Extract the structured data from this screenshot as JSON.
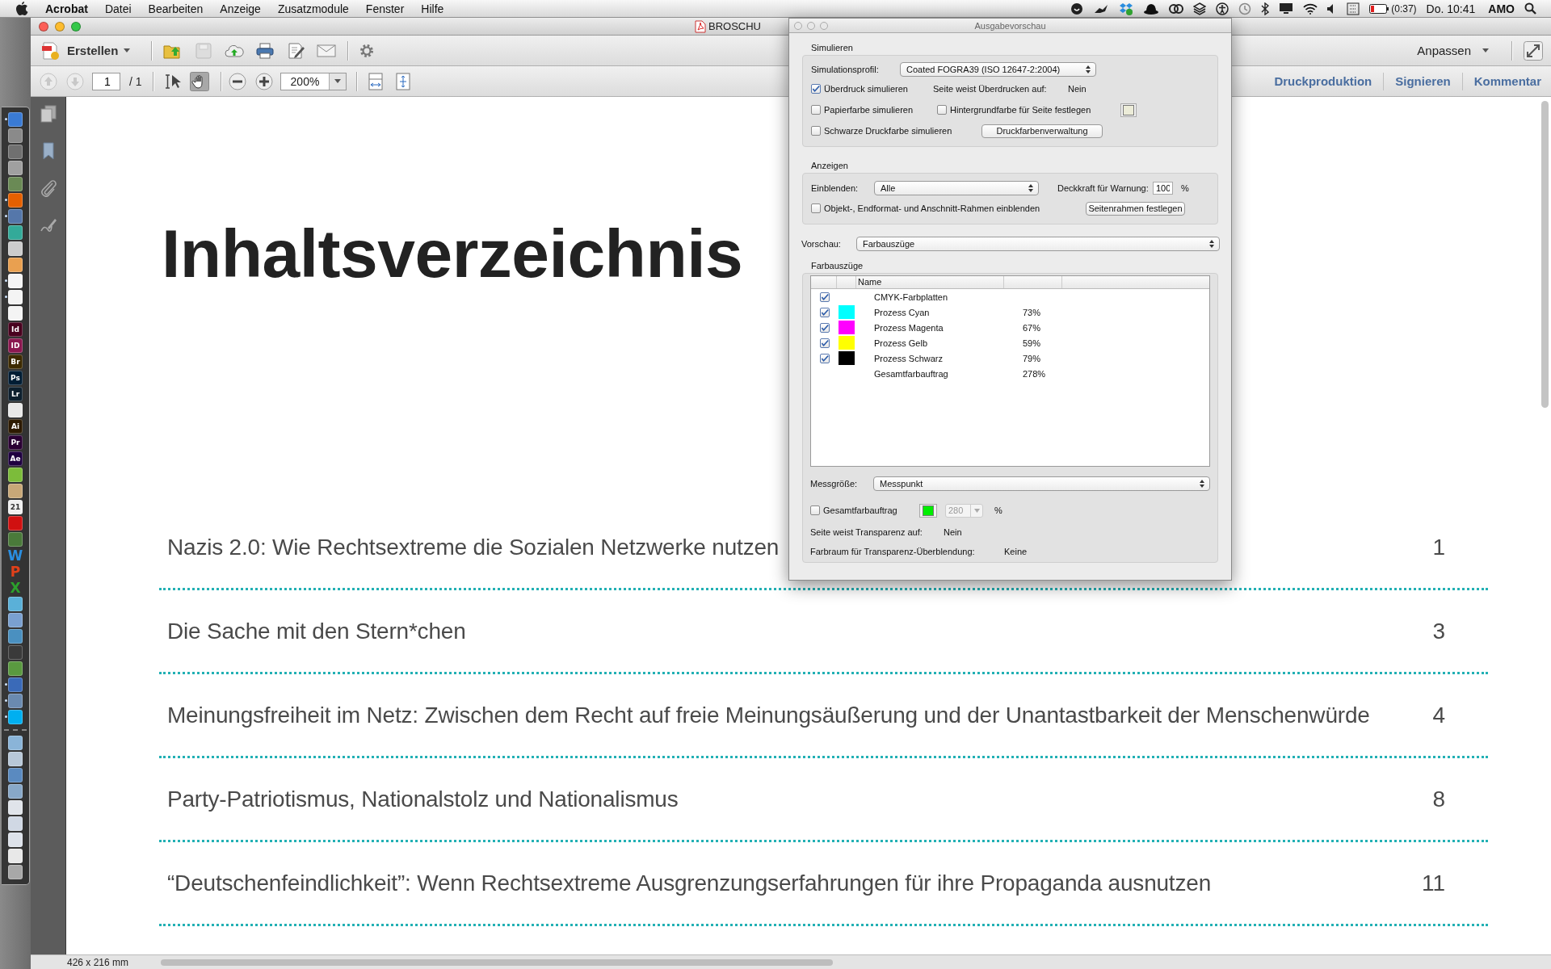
{
  "menu_bar": {
    "app": "Acrobat",
    "menus": [
      "Datei",
      "Bearbeiten",
      "Anzeige",
      "Zusatzmodule",
      "Fenster",
      "Hilfe"
    ],
    "battery_time": "(0:37)",
    "clock": "Do. 10:41",
    "user": "AMO"
  },
  "dock": [
    {
      "kind": "tile",
      "color": "#3a7bd5",
      "running": true
    },
    {
      "kind": "tile",
      "color": "#8a8a8a",
      "running": false
    },
    {
      "kind": "tile",
      "color": "#707070",
      "running": false
    },
    {
      "kind": "tile",
      "color": "#a0a0a0",
      "running": false
    },
    {
      "kind": "tile",
      "color": "#6a8a55",
      "running": false
    },
    {
      "kind": "tile",
      "color": "#e66000",
      "running": true
    },
    {
      "kind": "tile",
      "color": "#5577aa",
      "running": true
    },
    {
      "kind": "tile",
      "color": "#33aa99",
      "running": false
    },
    {
      "kind": "tile",
      "color": "#cccccc",
      "running": false
    },
    {
      "kind": "tile",
      "color": "#e9a050",
      "running": false
    },
    {
      "kind": "tile",
      "color": "#f4f4f4",
      "running": true
    },
    {
      "kind": "tile",
      "color": "#f4f4f4",
      "running": true
    },
    {
      "kind": "tile",
      "color": "#f4f4f4",
      "running": false
    },
    {
      "kind": "tile",
      "color": "#49021f",
      "label": "Id",
      "running": false
    },
    {
      "kind": "tile",
      "color": "#8b1850",
      "label": "ID",
      "running": false
    },
    {
      "kind": "tile",
      "color": "#3d2a00",
      "label": "Br",
      "running": false
    },
    {
      "kind": "tile",
      "color": "#001d34",
      "label": "Ps",
      "running": false
    },
    {
      "kind": "tile",
      "color": "#0d1f2d",
      "label": "Lr",
      "running": false
    },
    {
      "kind": "tile",
      "color": "#e8e8e8",
      "running": false
    },
    {
      "kind": "tile",
      "color": "#2d1a00",
      "label": "Ai",
      "running": false
    },
    {
      "kind": "tile",
      "color": "#2a0033",
      "label": "Pr",
      "running": false
    },
    {
      "kind": "tile",
      "color": "#1f0040",
      "label": "Ae",
      "running": false
    },
    {
      "kind": "tile",
      "color": "#7cbc3a",
      "running": false
    },
    {
      "kind": "tile",
      "color": "#c8a878",
      "running": false
    },
    {
      "kind": "tile",
      "color": "#f0f0f0",
      "label": "21",
      "running": false
    },
    {
      "kind": "tile",
      "color": "#d01010",
      "running": false
    },
    {
      "kind": "tile",
      "color": "#4a7a3a",
      "running": false
    },
    {
      "kind": "glyph",
      "color": "#2a8ee0",
      "label": "W",
      "running": false
    },
    {
      "kind": "glyph",
      "color": "#e0401a",
      "label": "P",
      "running": false
    },
    {
      "kind": "glyph",
      "color": "#2ca02c",
      "label": "X",
      "running": false
    },
    {
      "kind": "tile",
      "color": "#5ab0d8",
      "running": false
    },
    {
      "kind": "tile",
      "color": "#7aa0d0",
      "running": false
    },
    {
      "kind": "tile",
      "color": "#4a90c0",
      "running": false
    },
    {
      "kind": "tile",
      "color": "#3a3a3a",
      "running": false
    },
    {
      "kind": "tile",
      "color": "#5a9a40",
      "running": false
    },
    {
      "kind": "tile",
      "color": "#3a6ab8",
      "running": true
    },
    {
      "kind": "tile",
      "color": "#6a8ab0",
      "running": true
    },
    {
      "kind": "tile",
      "color": "#00aff0",
      "running": true
    },
    {
      "kind": "separator"
    },
    {
      "kind": "tile",
      "color": "#8ab4d8",
      "running": false
    },
    {
      "kind": "tile",
      "color": "#b8c8d8",
      "running": false
    },
    {
      "kind": "tile",
      "color": "#5a8ac0",
      "running": false
    },
    {
      "kind": "tile",
      "color": "#88a8c8",
      "running": false
    },
    {
      "kind": "tile",
      "color": "#e0e4ea",
      "running": false
    },
    {
      "kind": "tile",
      "color": "#d0d8e4",
      "running": false
    },
    {
      "kind": "tile",
      "color": "#dde2ea",
      "running": false
    },
    {
      "kind": "tile",
      "color": "#e8e8e8",
      "running": false
    },
    {
      "kind": "tile",
      "color": "#a8a8a8",
      "running": false
    }
  ],
  "window": {
    "title": "BROSCHU"
  },
  "toolbar": {
    "create_button": "Erstellen",
    "customize_button": "Anpassen",
    "page_number": "1",
    "page_total": "/ 1",
    "zoom": "200%"
  },
  "task_tabs": [
    {
      "label": "Druckproduktion",
      "selected": false
    },
    {
      "label": "Signieren",
      "selected": false
    },
    {
      "label": "Kommentar",
      "selected": false
    }
  ],
  "document": {
    "heading": "Inhaltsverzeichnis",
    "toc": [
      {
        "title": "Nazis 2.0: Wie Rechtsextreme die Sozialen Netzwerke nutzen",
        "page": "1"
      },
      {
        "title": "Die Sache mit den Stern*chen",
        "page": "3"
      },
      {
        "title": "Meinungsfreiheit im Netz: Zwischen dem Recht auf freie Meinungsäußerung und der Unantastbarkeit der Menschenwürde",
        "page": "4"
      },
      {
        "title": "Party-Patriotismus, Nationalstolz und Nationalismus",
        "page": "8"
      },
      {
        "title": "“Deutschenfeindlichkeit”: Wenn Rechtsextreme Ausgrenzungserfahrungen für ihre Propaganda ausnutzen",
        "page": "11"
      }
    ]
  },
  "status_bar": {
    "page_size": "426 x 216 mm"
  },
  "output_preview": {
    "title": "Ausgabevorschau",
    "simulate": {
      "label": "Simulieren",
      "profile_label": "Simulationsprofil:",
      "profile": "Coated FOGRA39 (ISO 12647-2:2004)",
      "simulate_overprint": {
        "label": "Überdruck simulieren",
        "checked": true
      },
      "overprint_label": "Seite weist Überdrucken auf:",
      "overprint_value": "Nein",
      "paper_color": {
        "label": "Papierfarbe simulieren",
        "checked": false
      },
      "background_color": {
        "label": "Hintergrundfarbe für Seite festlegen",
        "checked": false
      },
      "black_ink": {
        "label": "Schwarze Druckfarbe simulieren",
        "checked": false
      },
      "ink_manager_button": "Druckfarbenverwaltung"
    },
    "show": {
      "label": "Anzeigen",
      "show_label": "Einblenden:",
      "show_value": "Alle",
      "opacity_label": "Deckkraft für Warnung:",
      "opacity_value": "100",
      "opacity_unit": "%",
      "frames": {
        "label": "Objekt-, Endformat- und Anschnitt-Rahmen einblenden",
        "checked": false
      },
      "page_boxes_button": "Seitenrahmen festlegen"
    },
    "preview_label": "Vorschau:",
    "preview_value": "Farbauszüge",
    "separations": {
      "label": "Farbauszüge",
      "column_name": "Name",
      "rows": [
        {
          "kind": "plate",
          "name": "CMYK-Farbplatten",
          "checked": true
        },
        {
          "kind": "plate",
          "name": "Prozess Cyan",
          "checked": true,
          "color": "#00ffff",
          "coverage": "73%"
        },
        {
          "kind": "plate",
          "name": "Prozess Magenta",
          "checked": true,
          "color": "#ff00ff",
          "coverage": "67%"
        },
        {
          "kind": "plate",
          "name": "Prozess Gelb",
          "checked": true,
          "color": "#ffff00",
          "coverage": "59%"
        },
        {
          "kind": "plate",
          "name": "Prozess Schwarz",
          "checked": true,
          "color": "#000000",
          "coverage": "79%"
        },
        {
          "kind": "total",
          "name": "Gesamtfarbauftrag",
          "coverage": "278%"
        }
      ]
    },
    "sample_size_label": "Messgröße:",
    "sample_size": "Messpunkt",
    "total_coverage": {
      "label": "Gesamtfarbauftrag",
      "checked": false,
      "color": "#00ee00",
      "value": "280",
      "unit": "%"
    },
    "transparency_label": "Seite weist Transparenz auf:",
    "transparency_value": "Nein",
    "blending_label": "Farbraum für Transparenz-Überblendung:",
    "blending_value": "Keine"
  }
}
